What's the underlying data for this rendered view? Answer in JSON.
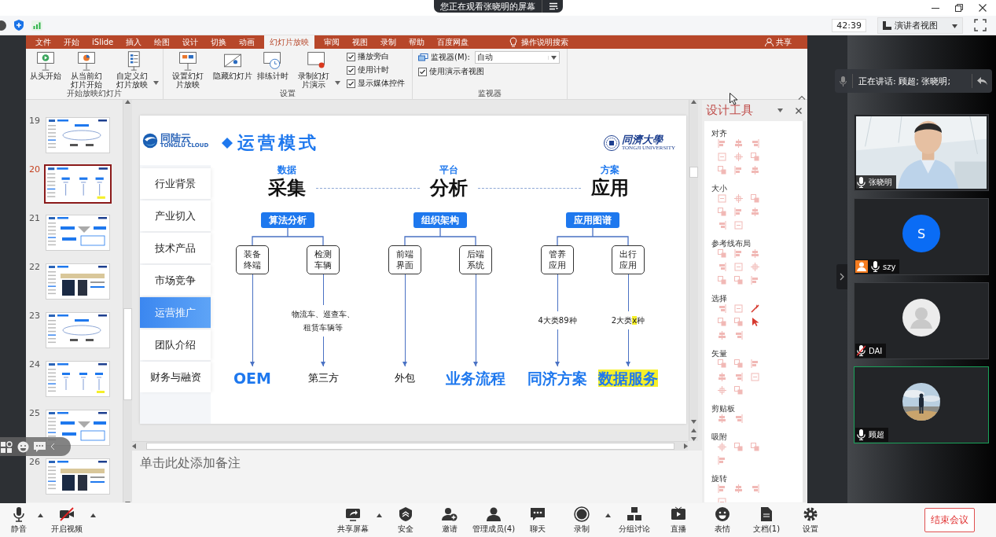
{
  "share_banner": {
    "text": "您正在观看张晓明的屏幕"
  },
  "meeting_bar": {
    "timer": "42:39",
    "view_button": "演讲者视图"
  },
  "ribbon": {
    "tabs": [
      {
        "label": "文件",
        "selected": false
      },
      {
        "label": "开始",
        "selected": false
      },
      {
        "label": "iSlide",
        "selected": false
      },
      {
        "label": "插入",
        "selected": false
      },
      {
        "label": "绘图",
        "selected": false
      },
      {
        "label": "设计",
        "selected": false
      },
      {
        "label": "切换",
        "selected": false
      },
      {
        "label": "动画",
        "selected": false
      },
      {
        "label": "幻灯片放映",
        "selected": true
      },
      {
        "label": "审阅",
        "selected": false
      },
      {
        "label": "视图",
        "selected": false
      },
      {
        "label": "录制",
        "selected": false
      },
      {
        "label": "帮助",
        "selected": false
      },
      {
        "label": "百度网盘",
        "selected": false
      }
    ],
    "tell_me": "操作说明搜索",
    "share": "共享",
    "groups": [
      {
        "label": "开始放映幻灯片",
        "items": [
          {
            "kind": "button",
            "label": "从头开始",
            "has_menu": false
          },
          {
            "kind": "button",
            "label": "从当前幻灯片开始",
            "has_menu": false
          },
          {
            "kind": "button",
            "label": "自定义幻灯片放映",
            "has_menu": true
          }
        ]
      },
      {
        "label": "设置",
        "items": [
          {
            "kind": "button",
            "label": "设置幻灯片放映",
            "has_menu": false
          },
          {
            "kind": "button",
            "label": "隐藏幻灯片",
            "has_menu": false
          },
          {
            "kind": "button",
            "label": "排练计时",
            "has_menu": false
          },
          {
            "kind": "button",
            "label": "录制幻灯片演示",
            "has_menu": true
          },
          {
            "kind": "checkbox",
            "label": "播放旁白",
            "checked": true
          },
          {
            "kind": "checkbox",
            "label": "使用计时",
            "checked": true
          },
          {
            "kind": "checkbox",
            "label": "显示媒体控件",
            "checked": true
          }
        ]
      },
      {
        "label": "监视器",
        "items": [
          {
            "kind": "dropdown",
            "label": "监视器(M):",
            "value": "自动"
          },
          {
            "kind": "checkbox",
            "label": "使用演示者视图",
            "checked": true
          }
        ]
      }
    ]
  },
  "thumbnails": [
    {
      "number": "19",
      "selected": false
    },
    {
      "number": "20",
      "selected": true
    },
    {
      "number": "21",
      "selected": false
    },
    {
      "number": "22",
      "selected": false
    },
    {
      "number": "23",
      "selected": false
    },
    {
      "number": "24",
      "selected": false
    },
    {
      "number": "25",
      "selected": false
    },
    {
      "number": "26",
      "selected": false
    }
  ],
  "slide": {
    "logo": {
      "name": "同陆云",
      "subtitle": "TONGLU CLOUD"
    },
    "menu": [
      {
        "label": "行业背景",
        "selected": false
      },
      {
        "label": "产业切入",
        "selected": false
      },
      {
        "label": "技术产品",
        "selected": false
      },
      {
        "label": "市场竞争",
        "selected": false
      },
      {
        "label": "运营推广",
        "selected": true
      },
      {
        "label": "团队介绍",
        "selected": false
      },
      {
        "label": "财务与融资",
        "selected": false
      }
    ],
    "title": "运营模式",
    "partner": {
      "name": "同濟大學",
      "subtitle": "TONGJI UNIVERSITY"
    },
    "columns": [
      {
        "caption": "数据",
        "heading": "采集",
        "chip": "算法分析",
        "branches": [
          {
            "box": "装备终端",
            "target": {
              "text": "OEM",
              "kind": "accent",
              "highlight": false
            }
          },
          {
            "box": "检测车辆",
            "note": [
              {
                "text": "物流车、巡查车、租赁车辆等",
                "highlight": false
              }
            ],
            "target": {
              "text": "第三方",
              "kind": "plain",
              "highlight": false
            }
          }
        ]
      },
      {
        "caption": "平台",
        "heading": "分析",
        "chip": "组织架构",
        "branches": [
          {
            "box": "前端界面",
            "target": {
              "text": "外包",
              "kind": "plain",
              "highlight": false
            }
          },
          {
            "box": "后端系统",
            "target": {
              "text": "业务流程",
              "kind": "accent",
              "highlight": false
            }
          }
        ]
      },
      {
        "caption": "方案",
        "heading": "应用",
        "chip": "应用图谱",
        "branches": [
          {
            "box": "管养应用",
            "note": [
              {
                "text": "4大类89种",
                "highlight": false
              }
            ],
            "target": {
              "text": "同济方案",
              "kind": "accent",
              "highlight": false
            }
          },
          {
            "box": "出行应用",
            "note": [
              {
                "text": "2大类",
                "highlight": false
              },
              {
                "text": "x",
                "highlight": true
              },
              {
                "text": "种",
                "highlight": false
              }
            ],
            "target": {
              "text": "数据服务",
              "kind": "accent",
              "highlight": true
            }
          }
        ]
      }
    ]
  },
  "notes": {
    "placeholder": "单击此处添加备注"
  },
  "design": {
    "title": "设计工具",
    "sections": [
      {
        "heading": "对齐",
        "tools": [
          {
            "disabled": true
          },
          {
            "disabled": true
          },
          {
            "disabled": true
          },
          {
            "disabled": true
          },
          {
            "disabled": true
          },
          {
            "disabled": true
          },
          {
            "disabled": true
          },
          {
            "disabled": true
          },
          {
            "disabled": true
          }
        ]
      },
      {
        "heading": "大小",
        "tools": [
          {
            "disabled": true
          },
          {
            "disabled": true
          },
          {
            "disabled": true
          },
          {
            "disabled": true
          },
          {
            "disabled": true
          },
          {
            "disabled": true
          },
          {
            "disabled": true
          },
          {
            "disabled": true
          }
        ]
      },
      {
        "heading": "参考线布局",
        "tools": [
          {
            "disabled": true
          },
          {
            "disabled": true
          },
          {
            "disabled": true
          },
          {
            "disabled": true
          },
          {
            "disabled": true
          },
          {
            "disabled": true
          },
          {
            "disabled": true
          },
          {
            "disabled": true
          },
          {
            "disabled": true
          }
        ]
      },
      {
        "heading": "选择",
        "tools": [
          {
            "disabled": true
          },
          {
            "disabled": true
          },
          {
            "disabled": false
          },
          {
            "disabled": true
          },
          {
            "disabled": true
          },
          {
            "disabled": false
          },
          {
            "disabled": true
          },
          {
            "disabled": true
          }
        ]
      },
      {
        "heading": "矢量",
        "tools": [
          {
            "disabled": true
          },
          {
            "disabled": true
          },
          {
            "disabled": true
          },
          {
            "disabled": true
          },
          {
            "disabled": true
          },
          {
            "disabled": true
          },
          {
            "disabled": true
          },
          {
            "disabled": true
          }
        ]
      },
      {
        "heading": "剪贴板",
        "tools": [
          {
            "disabled": true
          },
          {
            "disabled": true
          }
        ]
      },
      {
        "heading": "吸附",
        "tools": [
          {
            "disabled": true
          },
          {
            "disabled": true
          },
          {
            "disabled": true
          },
          {
            "disabled": true
          }
        ]
      },
      {
        "heading": "旋转",
        "tools": [
          {
            "disabled": true
          },
          {
            "disabled": true
          },
          {
            "disabled": true
          },
          {
            "disabled": true
          }
        ]
      }
    ]
  },
  "speaking": {
    "text": "正在讲话: 顾超; 张晓明;"
  },
  "participants": [
    {
      "name": "张晓明",
      "kind": "camera",
      "muted": false,
      "host": false,
      "active": false
    },
    {
      "name": "szy",
      "kind": "initial",
      "initial": "S",
      "muted": false,
      "host": true,
      "active": false
    },
    {
      "name": "DAI",
      "kind": "placeholder",
      "muted": true,
      "host": false,
      "active": false
    },
    {
      "name": "顾超",
      "muted": false,
      "host": false,
      "active": true
    }
  ],
  "toolbar": {
    "left": [
      {
        "label": "静音",
        "has_menu": true,
        "crossed": false
      },
      {
        "label": "开启视频",
        "has_menu": true,
        "crossed": true
      }
    ],
    "center": [
      {
        "label": "共享屏幕",
        "has_menu": true
      },
      {
        "label": "安全",
        "has_menu": false
      },
      {
        "label": "邀请",
        "has_menu": false
      },
      {
        "label": "管理成员(4)",
        "has_menu": false
      },
      {
        "label": "聊天",
        "has_menu": false
      },
      {
        "label": "录制",
        "has_menu": true
      },
      {
        "label": "分组讨论",
        "has_menu": false
      },
      {
        "label": "直播",
        "has_menu": false
      },
      {
        "label": "表情",
        "has_menu": false
      },
      {
        "label": "文档(1)",
        "has_menu": false
      },
      {
        "label": "设置",
        "has_menu": false
      }
    ],
    "end_button": "结束会议"
  }
}
